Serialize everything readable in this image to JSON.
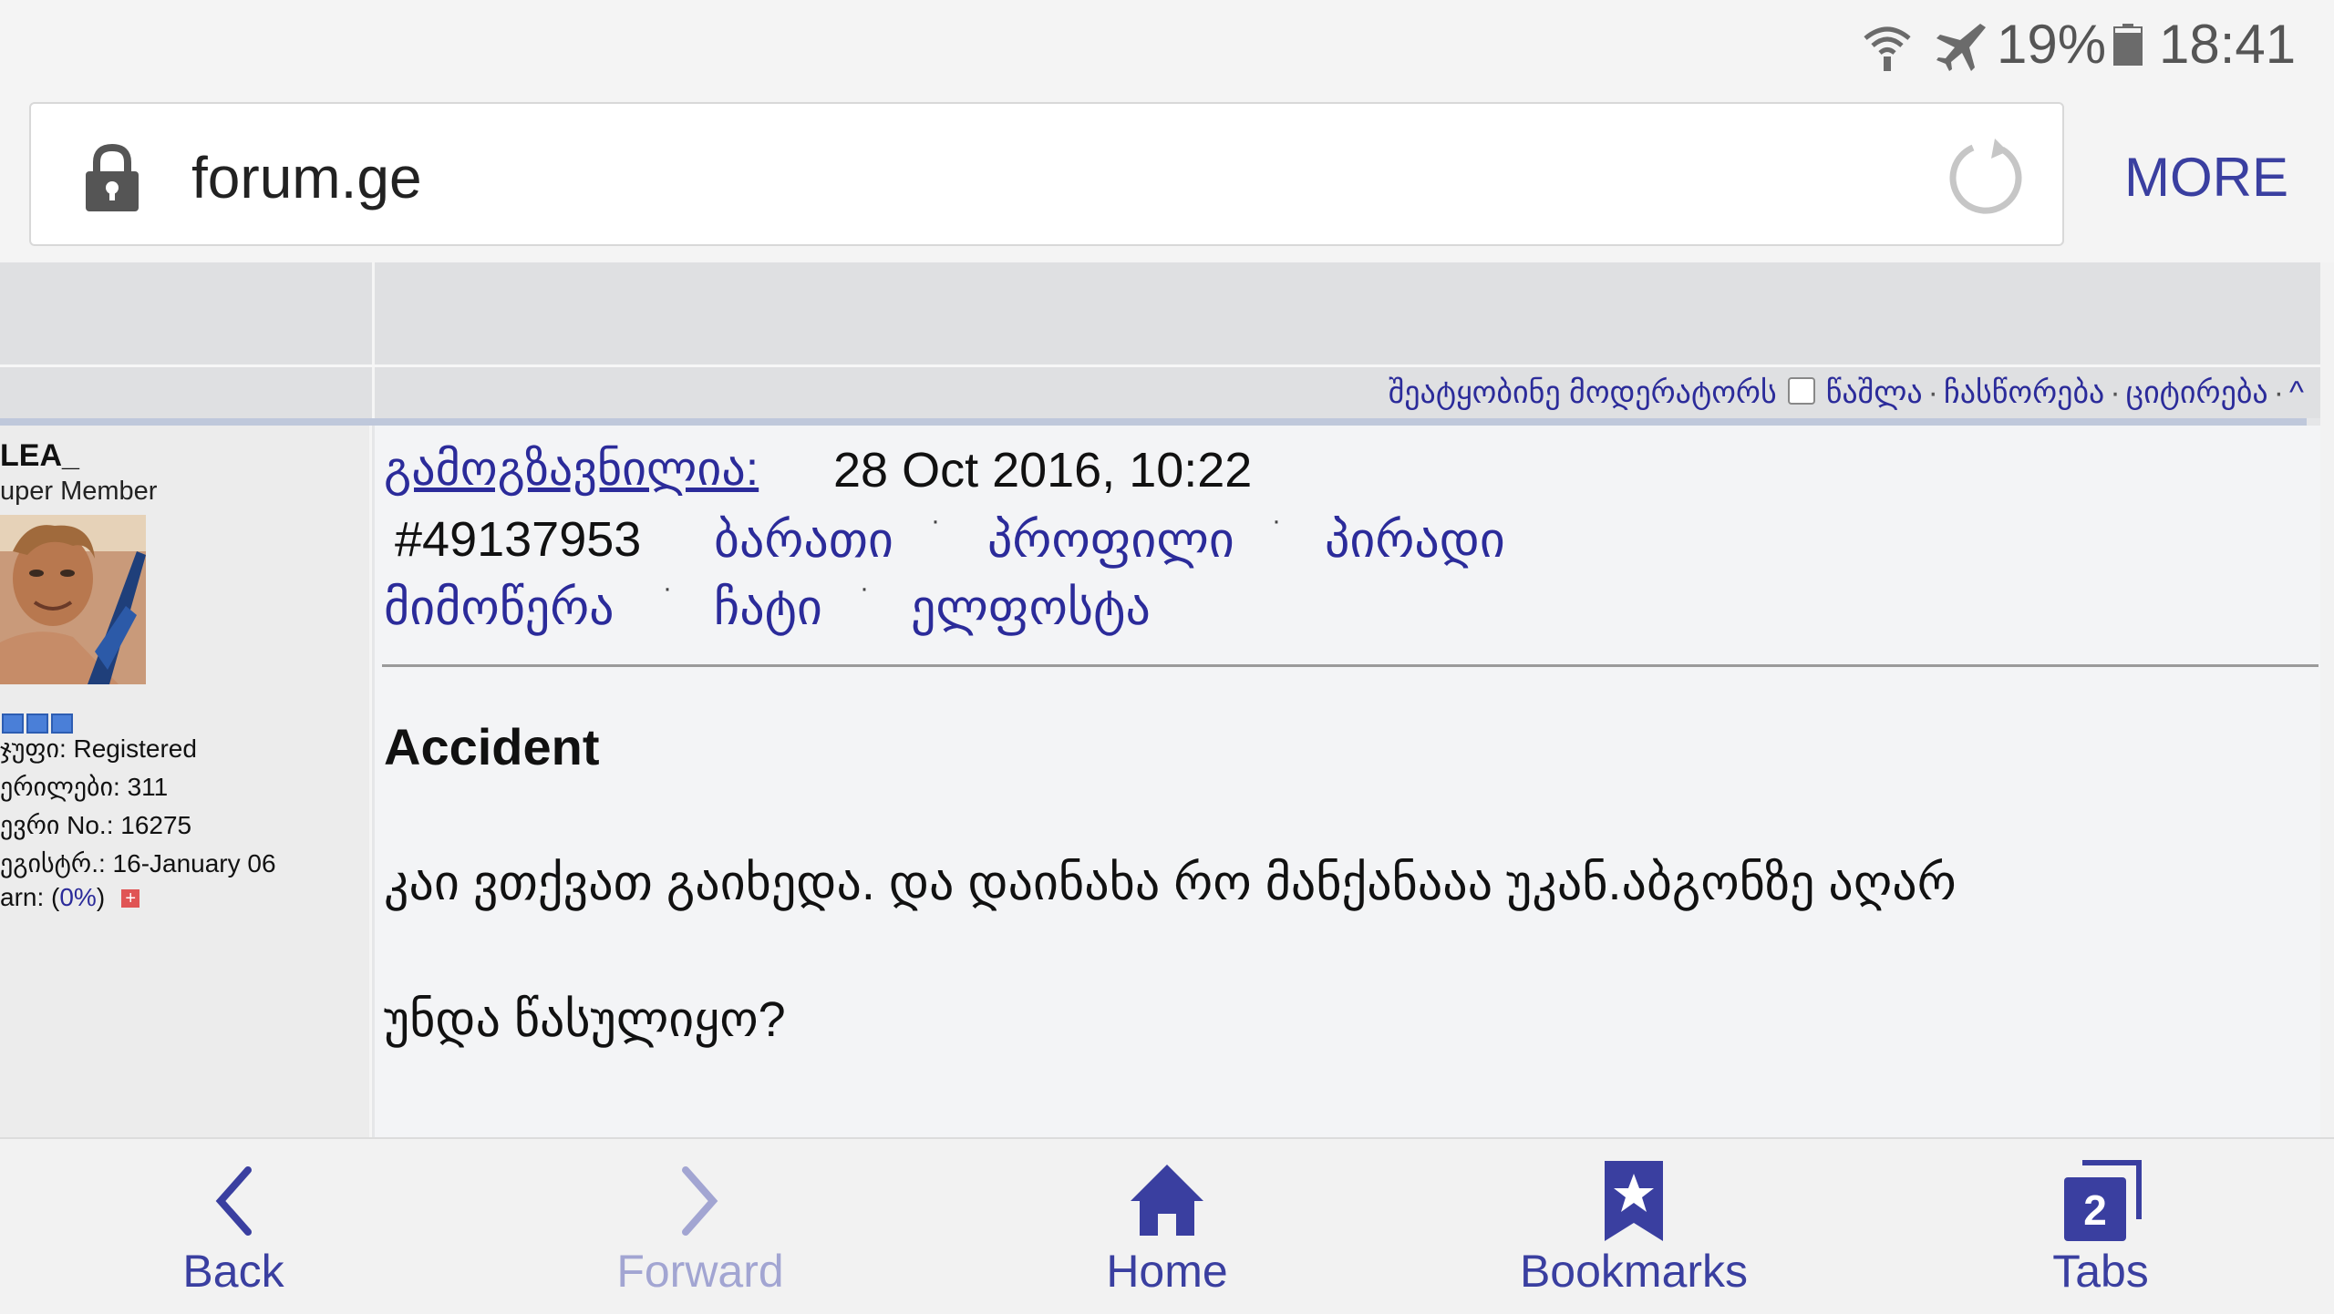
{
  "status_bar": {
    "battery": "19%",
    "time": "18:41",
    "icons": [
      "wifi-icon",
      "airplane-mode-icon",
      "battery-icon"
    ]
  },
  "address_bar": {
    "url": "forum.ge",
    "more_label": "MORE",
    "icons": [
      "lock-icon",
      "reload-icon"
    ]
  },
  "mod_bar": {
    "report": "შეატყობინე მოდერატორს",
    "delete": "წაშლა",
    "edit": "ჩასწორება",
    "quote": "ციტირება",
    "up": "^",
    "separator": "·"
  },
  "user": {
    "name": "LEA_",
    "rank": "uper Member",
    "group": "ჯუფი: Registered",
    "posts": "ერილები: 311",
    "member_no": "ევრი No.: 16275",
    "registered": "ეგისტრ.: 16-January 06",
    "warn_prefix": "arn: (",
    "warn_value": "0%",
    "warn_suffix": ")",
    "warn_symbol": "+"
  },
  "post": {
    "sent_label": "გამოგზავნილია:",
    "sent_date": "28 Oct 2016, 10:22",
    "post_id": "#49137953",
    "links": {
      "card": "ბარათი",
      "profile": "პროფილი",
      "private_1": "პირადი",
      "private_2": "მიმოწერა",
      "chat": "ჩატი",
      "email": "ელფოსტა"
    },
    "title": "Accident",
    "body_line1": "კაი ვთქვათ გაიხედა. და დაინახა რო მანქანააა უკან.აბგონზე აღარ",
    "body_line2": "უნდა წასულიყო?"
  },
  "bottom_nav": {
    "back": "Back",
    "forward": "Forward",
    "home": "Home",
    "bookmarks": "Bookmarks",
    "tabs": "Tabs",
    "tabs_count": "2"
  },
  "colors": {
    "accent": "#3a3fa0",
    "link": "#2b2b9a",
    "disabled": "#a2a5d2"
  }
}
